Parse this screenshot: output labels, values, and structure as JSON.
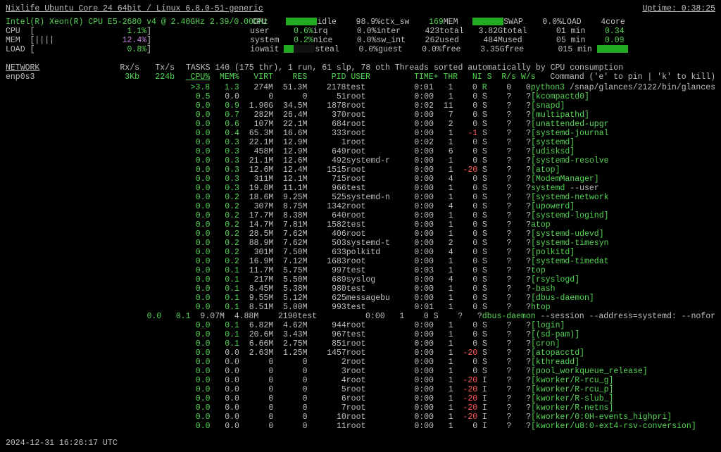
{
  "header": {
    "host": "Nixlife Ubuntu Core 24 64bit / Linux 6.8.0-51-generic",
    "uptime_label": "Uptime:",
    "uptime": "0:38:25"
  },
  "cpu_info": {
    "model": "Intel(R) Xeon(R) CPU E5-2680 v4 @ 2.40GHz 2.39/0.00GHz"
  },
  "summary": {
    "col0": {
      "cpu_label": "CPU",
      "cpu_bar": "[",
      "cpu_pct": "1.1%",
      "mem_label": "MEM",
      "mem_bar": "[||||",
      "mem_pct": "12.4%",
      "load_label": "LOAD",
      "load_bar": "[",
      "load_pct": "0.8%"
    },
    "col1": {
      "r1": {
        "k": "CPU",
        "bar": 100,
        "v": ""
      },
      "r2": {
        "k": "user",
        "v": "0.6%"
      },
      "r3": {
        "k": "system",
        "v": "0.2%"
      },
      "r4": {
        "k": "iowait",
        "bar": 30,
        "v": ""
      }
    },
    "col2": {
      "r1": {
        "k": "idle",
        "v": "98.9%"
      },
      "r2": {
        "k": "irq",
        "v": "0.0%"
      },
      "r3": {
        "k": "nice",
        "v": "0.0%"
      },
      "r4": {
        "k": "steal",
        "v": "0.0%"
      }
    },
    "col3": {
      "r1": {
        "k": "ctx_sw",
        "v": "169"
      },
      "r2": {
        "k": "inter",
        "v": "423"
      },
      "r3": {
        "k": "sw_int",
        "v": "262"
      },
      "r4": {
        "k": "guest",
        "v": "0.0%"
      }
    },
    "col4": {
      "r1": {
        "k": "MEM",
        "bar": 100,
        "v": ""
      },
      "r2": {
        "k": "total",
        "v": "3.82G"
      },
      "r3": {
        "k": "used",
        "v": "484M"
      },
      "r4": {
        "k": "free",
        "v": "3.35G"
      }
    },
    "col5": {
      "r1": {
        "k": "SWAP",
        "v": "0.0%"
      },
      "r2": {
        "k": "total",
        "v": "0"
      },
      "r3": {
        "k": "used",
        "v": "0"
      },
      "r4": {
        "k": "free",
        "v": "0"
      }
    },
    "col6": {
      "r1": {
        "k": "LOAD",
        "v": "4core"
      },
      "r2": {
        "k": "1 min",
        "v": "0.34"
      },
      "r3": {
        "k": "5 min",
        "v": "0.09"
      },
      "r4": {
        "k": "15 min",
        "bar": 100,
        "v": ""
      }
    }
  },
  "network": {
    "title": "NETWORK",
    "rx_hdr": "Rx/s",
    "tx_hdr": "Tx/s",
    "iface": "enp0s3",
    "rx": "3Kb",
    "tx": "224b"
  },
  "tasks": {
    "line": "TASKS 140 (175 thr), 1 run, 61 slp, 78 oth Threads sorted automatically by CPU consumption",
    "hint": "Command ('e' to pin | 'k' to kill)",
    "headers": [
      "CPU%",
      "MEM%",
      "VIRT",
      "RES",
      "PID",
      "USER",
      "TIME+",
      "THR",
      "NI",
      "S",
      "R/s",
      "W/s"
    ]
  },
  "processes": [
    {
      "cpu": ">3.8",
      "mem": "1.3",
      "virt": "274M",
      "res": "51.3M",
      "pid": "2178",
      "user": "test",
      "time": "0:01",
      "thr": "1",
      "ni": "0",
      "st": "R",
      "rs": "0",
      "ws": "0",
      "cmd": "python3",
      "args": " /snap/glances/2122/bin/glances",
      "mcol": "g"
    },
    {
      "cpu": "0.5",
      "mem": "0.0",
      "virt": "0",
      "res": "0",
      "pid": "51",
      "user": "root",
      "time": "0:00",
      "thr": "1",
      "ni": "0",
      "st": "S",
      "rs": "?",
      "ws": "?",
      "cmd": "[kcompactd0]",
      "mcol": ""
    },
    {
      "cpu": "0.0",
      "mem": "0.9",
      "virt": "1.90G",
      "res": "34.5M",
      "pid": "1878",
      "user": "root",
      "time": "0:02",
      "thr": "11",
      "ni": "0",
      "st": "S",
      "rs": "?",
      "ws": "?",
      "cmd": "[snapd]",
      "mcol": "g"
    },
    {
      "cpu": "0.0",
      "mem": "0.7",
      "virt": "282M",
      "res": "26.4M",
      "pid": "370",
      "user": "root",
      "time": "0:00",
      "thr": "7",
      "ni": "0",
      "st": "S",
      "rs": "?",
      "ws": "?",
      "cmd": "[multipathd]",
      "mcol": "g"
    },
    {
      "cpu": "0.0",
      "mem": "0.6",
      "virt": "107M",
      "res": "22.1M",
      "pid": "684",
      "user": "root",
      "time": "0:00",
      "thr": "2",
      "ni": "0",
      "st": "S",
      "rs": "?",
      "ws": "?",
      "cmd": "[unattended-upgr",
      "mcol": "g"
    },
    {
      "cpu": "0.0",
      "mem": "0.4",
      "virt": "65.3M",
      "res": "16.6M",
      "pid": "333",
      "user": "root",
      "time": "0:00",
      "thr": "1",
      "ni": "-1",
      "st": "S",
      "rs": "?",
      "ws": "?",
      "cmd": "[systemd-journal",
      "mcol": "g",
      "nicol": "r"
    },
    {
      "cpu": "0.0",
      "mem": "0.3",
      "virt": "22.1M",
      "res": "12.9M",
      "pid": "1",
      "user": "root",
      "time": "0:02",
      "thr": "1",
      "ni": "0",
      "st": "S",
      "rs": "?",
      "ws": "?",
      "cmd": "[systemd]",
      "mcol": "g"
    },
    {
      "cpu": "0.0",
      "mem": "0.3",
      "virt": "458M",
      "res": "12.9M",
      "pid": "649",
      "user": "root",
      "time": "0:00",
      "thr": "6",
      "ni": "0",
      "st": "S",
      "rs": "?",
      "ws": "?",
      "cmd": "[udisksd]",
      "mcol": "g"
    },
    {
      "cpu": "0.0",
      "mem": "0.3",
      "virt": "21.1M",
      "res": "12.6M",
      "pid": "492",
      "user": "systemd-r",
      "time": "0:00",
      "thr": "1",
      "ni": "0",
      "st": "S",
      "rs": "?",
      "ws": "?",
      "cmd": "[systemd-resolve",
      "mcol": "g"
    },
    {
      "cpu": "0.0",
      "mem": "0.3",
      "virt": "12.6M",
      "res": "12.4M",
      "pid": "1515",
      "user": "root",
      "time": "0:00",
      "thr": "1",
      "ni": "-20",
      "st": "S",
      "rs": "?",
      "ws": "?",
      "cmd": "[atop]",
      "mcol": "g",
      "nicol": "r"
    },
    {
      "cpu": "0.0",
      "mem": "0.3",
      "virt": "311M",
      "res": "12.1M",
      "pid": "715",
      "user": "root",
      "time": "0:00",
      "thr": "4",
      "ni": "0",
      "st": "S",
      "rs": "?",
      "ws": "?",
      "cmd": "[ModemManager]",
      "mcol": "g"
    },
    {
      "cpu": "0.0",
      "mem": "0.3",
      "virt": "19.8M",
      "res": "11.1M",
      "pid": "966",
      "user": "test",
      "time": "0:00",
      "thr": "1",
      "ni": "0",
      "st": "S",
      "rs": "?",
      "ws": "?",
      "cmd": "systemd",
      "args": " --user",
      "mcol": "g"
    },
    {
      "cpu": "0.0",
      "mem": "0.2",
      "virt": "18.6M",
      "res": "9.25M",
      "pid": "525",
      "user": "systemd-n",
      "time": "0:00",
      "thr": "1",
      "ni": "0",
      "st": "S",
      "rs": "?",
      "ws": "?",
      "cmd": "[systemd-network",
      "mcol": "g"
    },
    {
      "cpu": "0.0",
      "mem": "0.2",
      "virt": "307M",
      "res": "8.75M",
      "pid": "1342",
      "user": "root",
      "time": "0:00",
      "thr": "4",
      "ni": "0",
      "st": "S",
      "rs": "?",
      "ws": "?",
      "cmd": "[upowerd]",
      "mcol": "g"
    },
    {
      "cpu": "0.0",
      "mem": "0.2",
      "virt": "17.7M",
      "res": "8.38M",
      "pid": "640",
      "user": "root",
      "time": "0:00",
      "thr": "1",
      "ni": "0",
      "st": "S",
      "rs": "?",
      "ws": "?",
      "cmd": "[systemd-logind]",
      "mcol": "g"
    },
    {
      "cpu": "0.0",
      "mem": "0.2",
      "virt": "14.7M",
      "res": "7.81M",
      "pid": "1582",
      "user": "test",
      "time": "0:00",
      "thr": "1",
      "ni": "0",
      "st": "S",
      "rs": "?",
      "ws": "?",
      "cmd": "atop",
      "mcol": "g"
    },
    {
      "cpu": "0.0",
      "mem": "0.2",
      "virt": "28.5M",
      "res": "7.62M",
      "pid": "406",
      "user": "root",
      "time": "0:00",
      "thr": "1",
      "ni": "0",
      "st": "S",
      "rs": "?",
      "ws": "?",
      "cmd": "[systemd-udevd]",
      "mcol": "g"
    },
    {
      "cpu": "0.0",
      "mem": "0.2",
      "virt": "88.9M",
      "res": "7.62M",
      "pid": "503",
      "user": "systemd-t",
      "time": "0:00",
      "thr": "2",
      "ni": "0",
      "st": "S",
      "rs": "?",
      "ws": "?",
      "cmd": "[systemd-timesyn",
      "mcol": "g"
    },
    {
      "cpu": "0.0",
      "mem": "0.2",
      "virt": "301M",
      "res": "7.50M",
      "pid": "633",
      "user": "polkitd",
      "time": "0:00",
      "thr": "4",
      "ni": "0",
      "st": "S",
      "rs": "?",
      "ws": "?",
      "cmd": "[polkitd]",
      "mcol": "g"
    },
    {
      "cpu": "0.0",
      "mem": "0.2",
      "virt": "16.9M",
      "res": "7.12M",
      "pid": "1683",
      "user": "root",
      "time": "0:00",
      "thr": "1",
      "ni": "0",
      "st": "S",
      "rs": "?",
      "ws": "?",
      "cmd": "[systemd-timedat",
      "mcol": "g"
    },
    {
      "cpu": "0.0",
      "mem": "0.1",
      "virt": "11.7M",
      "res": "5.75M",
      "pid": "997",
      "user": "test",
      "time": "0:03",
      "thr": "1",
      "ni": "0",
      "st": "S",
      "rs": "?",
      "ws": "?",
      "cmd": "top",
      "mcol": "g"
    },
    {
      "cpu": "0.0",
      "mem": "0.1",
      "virt": "217M",
      "res": "5.50M",
      "pid": "689",
      "user": "syslog",
      "time": "0:00",
      "thr": "4",
      "ni": "0",
      "st": "S",
      "rs": "?",
      "ws": "?",
      "cmd": "[rsyslogd]",
      "mcol": "g"
    },
    {
      "cpu": "0.0",
      "mem": "0.1",
      "virt": "8.45M",
      "res": "5.38M",
      "pid": "980",
      "user": "test",
      "time": "0:00",
      "thr": "1",
      "ni": "0",
      "st": "S",
      "rs": "?",
      "ws": "?",
      "cmd": "-bash",
      "mcol": "g"
    },
    {
      "cpu": "0.0",
      "mem": "0.1",
      "virt": "9.55M",
      "res": "5.12M",
      "pid": "625",
      "user": "messagebu",
      "time": "0:00",
      "thr": "1",
      "ni": "0",
      "st": "S",
      "rs": "?",
      "ws": "?",
      "cmd": "[dbus-daemon]",
      "mcol": "g"
    },
    {
      "cpu": "0.0",
      "mem": "0.1",
      "virt": "8.51M",
      "res": "5.00M",
      "pid": "993",
      "user": "test",
      "time": "0:01",
      "thr": "1",
      "ni": "0",
      "st": "S",
      "rs": "?",
      "ws": "?",
      "cmd": "htop",
      "mcol": "g"
    },
    {
      "cpu": "0.0",
      "mem": "0.1",
      "virt": "9.07M",
      "res": "4.88M",
      "pid": "2190",
      "user": "test",
      "time": "0:00",
      "thr": "1",
      "ni": "0",
      "st": "S",
      "rs": "?",
      "ws": "?",
      "cmd": "dbus-daemon",
      "args": " --session --address=systemd: --nofor",
      "mcol": "g"
    },
    {
      "cpu": "0.0",
      "mem": "0.1",
      "virt": "6.82M",
      "res": "4.62M",
      "pid": "944",
      "user": "root",
      "time": "0:00",
      "thr": "1",
      "ni": "0",
      "st": "S",
      "rs": "?",
      "ws": "?",
      "cmd": "[login]",
      "mcol": "g"
    },
    {
      "cpu": "0.0",
      "mem": "0.1",
      "virt": "20.6M",
      "res": "3.43M",
      "pid": "967",
      "user": "test",
      "time": "0:00",
      "thr": "1",
      "ni": "0",
      "st": "S",
      "rs": "?",
      "ws": "?",
      "cmd": "[(sd-pam)]",
      "mcol": "g"
    },
    {
      "cpu": "0.0",
      "mem": "0.1",
      "virt": "6.66M",
      "res": "2.75M",
      "pid": "851",
      "user": "root",
      "time": "0:00",
      "thr": "1",
      "ni": "0",
      "st": "S",
      "rs": "?",
      "ws": "?",
      "cmd": "[cron]",
      "mcol": "g"
    },
    {
      "cpu": "0.0",
      "mem": "0.0",
      "virt": "2.63M",
      "res": "1.25M",
      "pid": "1457",
      "user": "root",
      "time": "0:00",
      "thr": "1",
      "ni": "-20",
      "st": "S",
      "rs": "?",
      "ws": "?",
      "cmd": "[atopacctd]",
      "nicol": "r"
    },
    {
      "cpu": "0.0",
      "mem": "0.0",
      "virt": "0",
      "res": "0",
      "pid": "2",
      "user": "root",
      "time": "0:00",
      "thr": "1",
      "ni": "0",
      "st": "S",
      "rs": "?",
      "ws": "?",
      "cmd": "[kthreadd]"
    },
    {
      "cpu": "0.0",
      "mem": "0.0",
      "virt": "0",
      "res": "0",
      "pid": "3",
      "user": "root",
      "time": "0:00",
      "thr": "1",
      "ni": "0",
      "st": "S",
      "rs": "?",
      "ws": "?",
      "cmd": "[pool_workqueue_release]"
    },
    {
      "cpu": "0.0",
      "mem": "0.0",
      "virt": "0",
      "res": "0",
      "pid": "4",
      "user": "root",
      "time": "0:00",
      "thr": "1",
      "ni": "-20",
      "st": "I",
      "rs": "?",
      "ws": "?",
      "cmd": "[kworker/R-rcu_g]",
      "nicol": "r"
    },
    {
      "cpu": "0.0",
      "mem": "0.0",
      "virt": "0",
      "res": "0",
      "pid": "5",
      "user": "root",
      "time": "0:00",
      "thr": "1",
      "ni": "-20",
      "st": "I",
      "rs": "?",
      "ws": "?",
      "cmd": "[kworker/R-rcu_p]",
      "nicol": "r"
    },
    {
      "cpu": "0.0",
      "mem": "0.0",
      "virt": "0",
      "res": "0",
      "pid": "6",
      "user": "root",
      "time": "0:00",
      "thr": "1",
      "ni": "-20",
      "st": "I",
      "rs": "?",
      "ws": "?",
      "cmd": "[kworker/R-slub_]",
      "nicol": "r"
    },
    {
      "cpu": "0.0",
      "mem": "0.0",
      "virt": "0",
      "res": "0",
      "pid": "7",
      "user": "root",
      "time": "0:00",
      "thr": "1",
      "ni": "-20",
      "st": "I",
      "rs": "?",
      "ws": "?",
      "cmd": "[kworker/R-netns]",
      "nicol": "r"
    },
    {
      "cpu": "0.0",
      "mem": "0.0",
      "virt": "0",
      "res": "0",
      "pid": "10",
      "user": "root",
      "time": "0:00",
      "thr": "1",
      "ni": "-20",
      "st": "I",
      "rs": "?",
      "ws": "?",
      "cmd": "[kworker/0:0H-events_highpri]",
      "nicol": "r"
    },
    {
      "cpu": "0.0",
      "mem": "0.0",
      "virt": "0",
      "res": "0",
      "pid": "11",
      "user": "root",
      "time": "0:00",
      "thr": "1",
      "ni": "0",
      "st": "I",
      "rs": "?",
      "ws": "?",
      "cmd": "[kworker/u8:0-ext4-rsv-conversion]"
    }
  ],
  "footer": {
    "datetime": "2024-12-31 16:26:17 UTC"
  }
}
